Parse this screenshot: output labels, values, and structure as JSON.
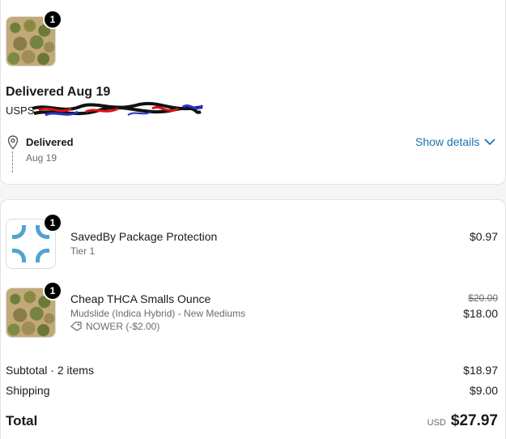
{
  "shipment": {
    "badge": "1",
    "title": "Delivered Aug 19",
    "carrier": "USPS",
    "status_label": "Delivered",
    "status_date": "Aug 19",
    "show_details": "Show details",
    "icons": [
      "location-pin-icon",
      "chevron-down-icon"
    ]
  },
  "items": [
    {
      "badge": "1",
      "name": "SavedBy Package Protection",
      "variant": "Tier 1",
      "price": "$0.97",
      "icon": "package-protection-logo"
    },
    {
      "badge": "1",
      "name": "Cheap THCA Smalls Ounce",
      "variant": "Mudslide (Indica Hybrid) - New Mediums",
      "discount": "NOWER (-$2.00)",
      "original_price": "$20.00",
      "price": "$18.00",
      "icon": "tag-icon"
    }
  ],
  "summary": {
    "subtotal_label": "Subtotal · 2 items",
    "subtotal_value": "$18.97",
    "shipping_label": "Shipping",
    "shipping_value": "$9.00",
    "total_label": "Total",
    "currency": "USD",
    "total_value": "$27.97"
  },
  "colors": {
    "link": "#1773b0",
    "protection_logo": "#4ea3cf",
    "badge": "#000000"
  }
}
